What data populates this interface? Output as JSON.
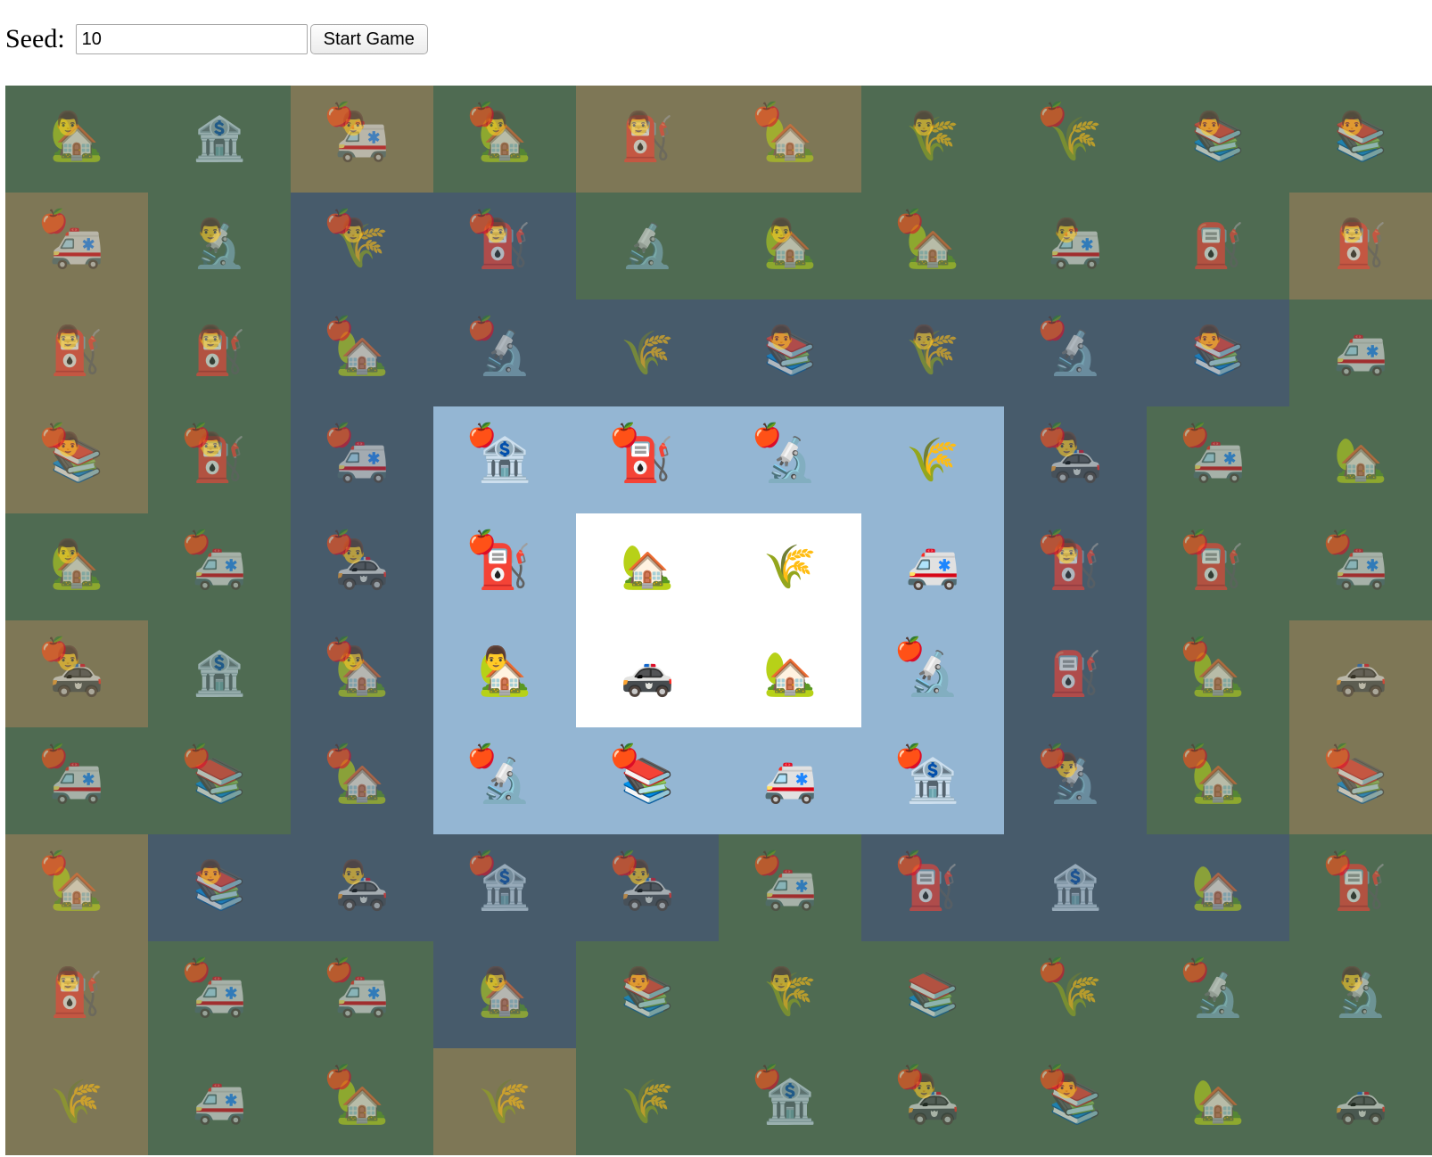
{
  "controls": {
    "seed_label": "Seed:",
    "seed_value": "10",
    "start_button_label": "Start Game"
  },
  "colors": {
    "grass": "#4f6b52",
    "sand": "#7e7756",
    "water": "#475b6b",
    "light_blue": "#94b6d3",
    "white": "#ffffff"
  },
  "glyphs": {
    "house": "🏡",
    "bank": "🏦",
    "ambulance": "🚑",
    "fuel": "⛽",
    "grain": "🌾",
    "books": "📚",
    "microscope": "🔬",
    "police-car": "🚓",
    "apple": "🍎",
    "person": "👨"
  },
  "board": {
    "rows": 10,
    "cols": 10,
    "cells": [
      [
        {
          "bg": "grass",
          "item": "house",
          "person": true
        },
        {
          "bg": "grass",
          "item": "bank"
        },
        {
          "bg": "sand",
          "item": "ambulance",
          "apple": true,
          "person": true
        },
        {
          "bg": "grass",
          "item": "house",
          "apple": true,
          "person": true
        },
        {
          "bg": "sand",
          "item": "fuel",
          "person": true
        },
        {
          "bg": "sand",
          "item": "house",
          "apple": true
        },
        {
          "bg": "grass",
          "item": "grain",
          "person": true
        },
        {
          "bg": "grass",
          "item": "grain",
          "apple": true
        },
        {
          "bg": "grass",
          "item": "books",
          "person": true
        },
        {
          "bg": "grass",
          "item": "books",
          "person": true
        }
      ],
      [
        {
          "bg": "sand",
          "item": "ambulance",
          "apple": true
        },
        {
          "bg": "grass",
          "item": "microscope",
          "person": true
        },
        {
          "bg": "water",
          "item": "grain",
          "apple": true,
          "person": true
        },
        {
          "bg": "water",
          "item": "fuel",
          "apple": true,
          "person": true
        },
        {
          "bg": "grass",
          "item": "microscope"
        },
        {
          "bg": "grass",
          "item": "house",
          "person": true
        },
        {
          "bg": "grass",
          "item": "house",
          "apple": true
        },
        {
          "bg": "grass",
          "item": "ambulance",
          "person": true
        },
        {
          "bg": "grass",
          "item": "fuel"
        },
        {
          "bg": "sand",
          "item": "fuel",
          "person": true
        }
      ],
      [
        {
          "bg": "sand",
          "item": "fuel",
          "person": true
        },
        {
          "bg": "grass",
          "item": "fuel",
          "person": true
        },
        {
          "bg": "water",
          "item": "house",
          "apple": true
        },
        {
          "bg": "water",
          "item": "microscope",
          "apple": true
        },
        {
          "bg": "water",
          "item": "grain"
        },
        {
          "bg": "water",
          "item": "books",
          "person": true
        },
        {
          "bg": "water",
          "item": "grain",
          "person": true
        },
        {
          "bg": "water",
          "item": "microscope",
          "apple": true
        },
        {
          "bg": "water",
          "item": "books",
          "person": true
        },
        {
          "bg": "grass",
          "item": "ambulance"
        }
      ],
      [
        {
          "bg": "sand",
          "item": "books",
          "apple": true,
          "person": true
        },
        {
          "bg": "grass",
          "item": "fuel",
          "apple": true,
          "person": true
        },
        {
          "bg": "water",
          "item": "ambulance",
          "apple": true
        },
        {
          "bg": "light_blue",
          "item": "bank",
          "apple": true
        },
        {
          "bg": "light_blue",
          "item": "fuel",
          "apple": true
        },
        {
          "bg": "light_blue",
          "item": "microscope",
          "apple": true
        },
        {
          "bg": "light_blue",
          "item": "grain"
        },
        {
          "bg": "water",
          "item": "police-car",
          "apple": true,
          "person": true
        },
        {
          "bg": "grass",
          "item": "ambulance",
          "apple": true
        },
        {
          "bg": "grass",
          "item": "house"
        }
      ],
      [
        {
          "bg": "grass",
          "item": "house",
          "person": true
        },
        {
          "bg": "grass",
          "item": "ambulance",
          "apple": true
        },
        {
          "bg": "water",
          "item": "police-car",
          "apple": true,
          "person": true
        },
        {
          "bg": "light_blue",
          "item": "fuel",
          "apple": true
        },
        {
          "bg": "white",
          "item": "house"
        },
        {
          "bg": "white",
          "item": "grain"
        },
        {
          "bg": "light_blue",
          "item": "ambulance"
        },
        {
          "bg": "water",
          "item": "fuel",
          "apple": true,
          "person": true
        },
        {
          "bg": "grass",
          "item": "fuel",
          "apple": true
        },
        {
          "bg": "grass",
          "item": "ambulance",
          "apple": true
        }
      ],
      [
        {
          "bg": "sand",
          "item": "police-car",
          "apple": true,
          "person": true
        },
        {
          "bg": "grass",
          "item": "bank"
        },
        {
          "bg": "water",
          "item": "house",
          "apple": true,
          "person": true
        },
        {
          "bg": "light_blue",
          "item": "house",
          "person": true
        },
        {
          "bg": "white",
          "item": "police-car"
        },
        {
          "bg": "white",
          "item": "house"
        },
        {
          "bg": "light_blue",
          "item": "microscope",
          "apple": true
        },
        {
          "bg": "water",
          "item": "fuel"
        },
        {
          "bg": "grass",
          "item": "house",
          "apple": true
        },
        {
          "bg": "sand",
          "item": "police-car"
        }
      ],
      [
        {
          "bg": "grass",
          "item": "ambulance",
          "apple": true
        },
        {
          "bg": "grass",
          "item": "books",
          "apple": true
        },
        {
          "bg": "water",
          "item": "house",
          "apple": true
        },
        {
          "bg": "light_blue",
          "item": "microscope",
          "apple": true
        },
        {
          "bg": "light_blue",
          "item": "books",
          "apple": true
        },
        {
          "bg": "light_blue",
          "item": "ambulance"
        },
        {
          "bg": "light_blue",
          "item": "bank",
          "apple": true
        },
        {
          "bg": "water",
          "item": "microscope",
          "apple": true,
          "person": true
        },
        {
          "bg": "grass",
          "item": "house",
          "apple": true
        },
        {
          "bg": "sand",
          "item": "books",
          "apple": true
        }
      ],
      [
        {
          "bg": "sand",
          "item": "house",
          "apple": true
        },
        {
          "bg": "water",
          "item": "books",
          "person": true
        },
        {
          "bg": "water",
          "item": "police-car",
          "person": true
        },
        {
          "bg": "water",
          "item": "bank",
          "apple": true
        },
        {
          "bg": "water",
          "item": "police-car",
          "apple": true,
          "person": true
        },
        {
          "bg": "grass",
          "item": "ambulance",
          "apple": true
        },
        {
          "bg": "water",
          "item": "fuel",
          "apple": true
        },
        {
          "bg": "water",
          "item": "bank"
        },
        {
          "bg": "water",
          "item": "house"
        },
        {
          "bg": "grass",
          "item": "fuel",
          "apple": true
        }
      ],
      [
        {
          "bg": "sand",
          "item": "fuel",
          "person": true
        },
        {
          "bg": "grass",
          "item": "ambulance",
          "apple": true
        },
        {
          "bg": "grass",
          "item": "ambulance",
          "apple": true
        },
        {
          "bg": "water",
          "item": "house",
          "person": true
        },
        {
          "bg": "grass",
          "item": "books",
          "person": true
        },
        {
          "bg": "grass",
          "item": "grain",
          "person": true
        },
        {
          "bg": "grass",
          "item": "books"
        },
        {
          "bg": "grass",
          "item": "grain",
          "apple": true
        },
        {
          "bg": "grass",
          "item": "microscope",
          "apple": true
        },
        {
          "bg": "grass",
          "item": "microscope",
          "person": true
        }
      ],
      [
        {
          "bg": "sand",
          "item": "grain"
        },
        {
          "bg": "grass",
          "item": "ambulance"
        },
        {
          "bg": "grass",
          "item": "house",
          "apple": true
        },
        {
          "bg": "sand",
          "item": "grain"
        },
        {
          "bg": "grass",
          "item": "grain"
        },
        {
          "bg": "grass",
          "item": "bank",
          "apple": true
        },
        {
          "bg": "grass",
          "item": "police-car",
          "apple": true,
          "person": true
        },
        {
          "bg": "grass",
          "item": "books",
          "apple": true,
          "person": true
        },
        {
          "bg": "grass",
          "item": "house"
        },
        {
          "bg": "grass",
          "item": "police-car"
        }
      ]
    ]
  }
}
